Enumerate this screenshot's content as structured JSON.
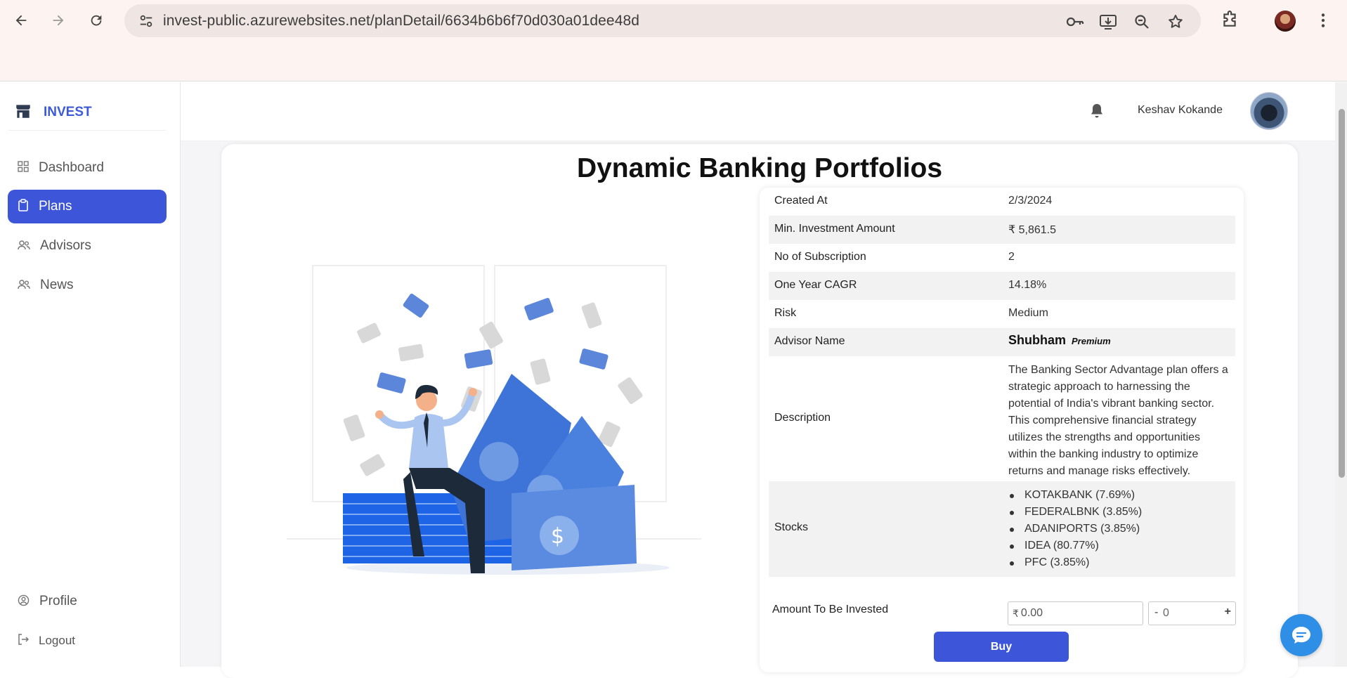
{
  "browser": {
    "url": "invest-public.azurewebsites.net/planDetail/6634b6b6f70d030a01dee48d"
  },
  "sidebar": {
    "brand": "INVEST",
    "items": [
      {
        "label": "Dashboard",
        "icon": "grid-icon",
        "active": false
      },
      {
        "label": "Plans",
        "icon": "clipboard-icon",
        "active": true
      },
      {
        "label": "Advisors",
        "icon": "users-icon",
        "active": false
      },
      {
        "label": "News",
        "icon": "users-icon",
        "active": false
      }
    ],
    "bottom": [
      {
        "label": "Profile",
        "icon": "user-circle-icon"
      },
      {
        "label": "Logout",
        "icon": "logout-icon"
      }
    ]
  },
  "header": {
    "username": "Keshav Kokande"
  },
  "plan": {
    "title": "Dynamic Banking Portfolios",
    "details": {
      "created_at_label": "Created At",
      "created_at": "2/3/2024",
      "min_investment_label": "Min. Investment Amount",
      "min_investment": "₹ 5,861.5",
      "subscriptions_label": "No of Subscription",
      "subscriptions": "2",
      "cagr_label": "One Year CAGR",
      "cagr": "14.18%",
      "risk_label": "Risk",
      "risk": "Medium",
      "advisor_label": "Advisor Name",
      "advisor_name": "Shubham",
      "advisor_badge": "Premium",
      "description_label": "Description",
      "description": "The Banking Sector Advantage plan offers a strategic approach to harnessing the potential of India's vibrant banking sector. This comprehensive financial strategy utilizes the strengths and opportunities within the banking industry to optimize returns and manage risks effectively.",
      "stocks_label": "Stocks",
      "stocks": [
        "KOTAKBANK (7.69%)",
        "FEDERALBNK (3.85%)",
        "ADANIPORTS (3.85%)",
        "IDEA (80.77%)",
        "PFC (3.85%)"
      ]
    },
    "invest": {
      "label": "Amount To Be Invested",
      "currency": "₹",
      "amount": "0.00",
      "minus": "-",
      "quantity": "0",
      "plus": "+",
      "buy_label": "Buy"
    }
  },
  "colors": {
    "accent": "#3d56d9",
    "chat": "#2f8ee5"
  }
}
